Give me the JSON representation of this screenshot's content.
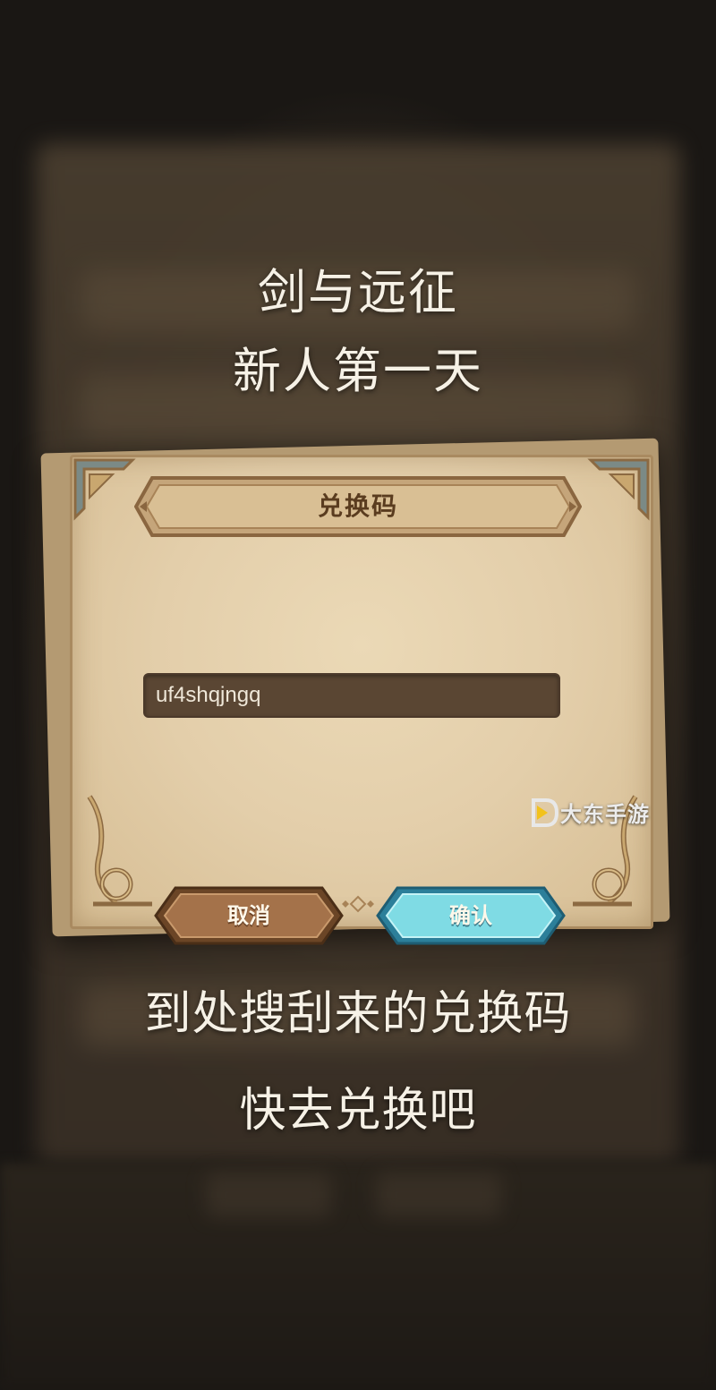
{
  "overlay": {
    "caption_top_line1": "剑与远征",
    "caption_top_line2": "新人第一天",
    "caption_bottom_line1": "到处搜刮来的兑换码",
    "caption_bottom_line2": "快去兑换吧"
  },
  "dialog": {
    "title": "兑换码",
    "input_value": "uf4shqjngq",
    "cancel_label": "取消",
    "confirm_label": "确认"
  },
  "watermark": {
    "text": "大东手游"
  },
  "colors": {
    "paper": "#e3ceaa",
    "input_bg": "#5a4633",
    "cancel_button": "#9a6a43",
    "confirm_button": "#6fd0dc",
    "banner": "#8a6640"
  }
}
